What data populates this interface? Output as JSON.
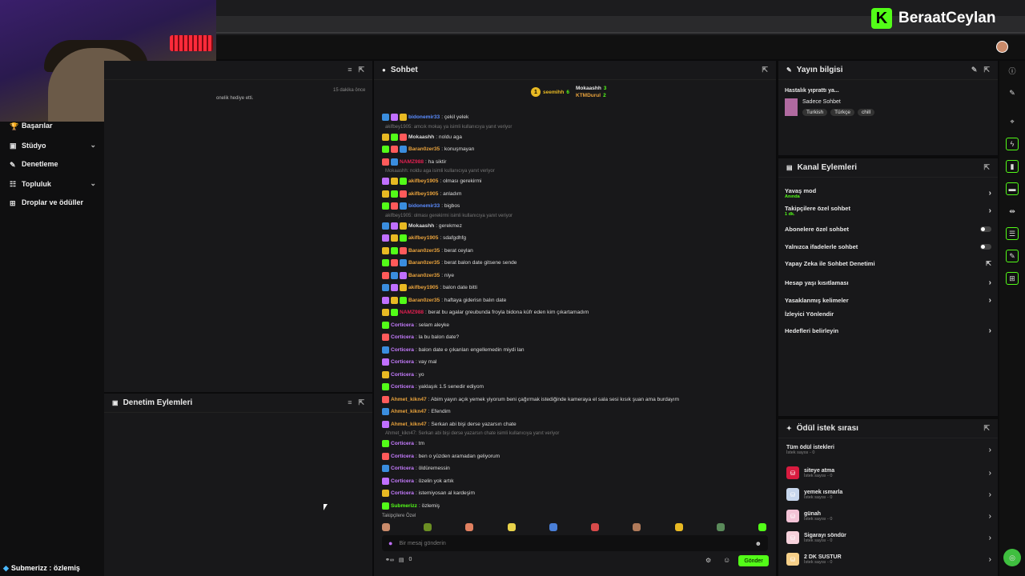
{
  "brand": {
    "logo_letter": "K",
    "name": "BeraatCeylan"
  },
  "sidebar": {
    "items": [
      {
        "label": "Başarılar",
        "icon": "trophy-icon"
      },
      {
        "label": "Stüdyo",
        "icon": "video-icon",
        "expand": true
      },
      {
        "label": "Denetleme",
        "icon": "wrench-icon"
      },
      {
        "label": "Topluluk",
        "icon": "people-icon",
        "expand": true
      },
      {
        "label": "Droplar ve ödüller",
        "icon": "gift-icon"
      }
    ]
  },
  "activity": {
    "snippet": "onelik hediye etti.",
    "time": "15 dakika önce"
  },
  "mod_actions": {
    "title": "Denetim Eylemleri"
  },
  "chat": {
    "title": "Sohbet",
    "leaderboard": [
      {
        "name": "seemihh",
        "count": "6"
      },
      {
        "name": "Mokaashh",
        "count": "3"
      },
      {
        "name": "KTMDurul",
        "count": "2"
      }
    ],
    "messages": [
      {
        "user": "bidonemir33",
        "text": ": çekil yelek",
        "color": "#5b8cff"
      },
      {
        "reply": "akifbey1905: amcık mokaş ya isimli kullanıcıya yanıt veriyor"
      },
      {
        "user": "Mokaashh",
        "text": ": noldu aga",
        "color": "#dddddd"
      },
      {
        "user": "Baran0zer35",
        "text": ": konuşmayan",
        "color": "#e8a23c"
      },
      {
        "user": "NAMZ988",
        "text": ": ha siktir",
        "color": "#e02050"
      },
      {
        "reply": "Mokaashh: noldu aga isimli kullanıcıya yanıt veriyor"
      },
      {
        "user": "akifbey1905",
        "text": ": olması gerekirmi",
        "color": "#e8a23c"
      },
      {
        "user": "akifbey1905",
        "text": ": anladım",
        "color": "#e8a23c"
      },
      {
        "user": "bidonemir33",
        "text": ": bigbos",
        "color": "#5b8cff"
      },
      {
        "reply": "akifbey1905: olması gerekirmi isimli kullanıcıya yanıt veriyor"
      },
      {
        "user": "Mokaashh",
        "text": ": gerekmez",
        "color": "#dddddd"
      },
      {
        "user": "akifbey1905",
        "text": ": sdafgdhfg",
        "color": "#e8a23c"
      },
      {
        "user": "Baran0zer35",
        "text": ": berat ceylan",
        "color": "#e8a23c"
      },
      {
        "user": "Baran0zer35",
        "text": ": berat balon date gitsene sende",
        "color": "#e8a23c"
      },
      {
        "user": "Baran0zer35",
        "text": ": niye",
        "color": "#e8a23c"
      },
      {
        "user": "akifbey1905",
        "text": ": balon date bitti",
        "color": "#e8a23c"
      },
      {
        "user": "Baran0zer35",
        "text": ": haftaya giderisn balın date",
        "color": "#e8a23c"
      },
      {
        "user": "NAMZ988",
        "text": ": berat bu agalar greubunda froyla bidona küfr eden kim çıkartamadım",
        "color": "#e02050"
      },
      {
        "user": "Corticera",
        "text": ": selam aleyke",
        "color": "#c67cff"
      },
      {
        "user": "Corticera",
        "text": ": la bu balon date?",
        "color": "#c67cff"
      },
      {
        "user": "Corticera",
        "text": ": balon date e çıkanları engellemedin miydi lan",
        "color": "#c67cff"
      },
      {
        "user": "Corticera",
        "text": ": vay mal",
        "color": "#c67cff"
      },
      {
        "user": "Corticera",
        "text": ": yo",
        "color": "#c67cff"
      },
      {
        "user": "Corticera",
        "text": ": yaklaşık 1.5 senedir ediyom",
        "color": "#c67cff"
      },
      {
        "user": "Ahmet_kikn47",
        "text": ": Abim yayın açık yemek yiyorum beni çağırmak istediğinde kameraya el sala sesi kısık şuan ama burdayım",
        "color": "#e8a23c"
      },
      {
        "user": "Ahmet_kikn47",
        "text": ": Efendim",
        "color": "#e8a23c"
      },
      {
        "user": "Ahmet_kikn47",
        "text": ": Serkan abi bişi derse yazarsın chate",
        "color": "#e8a23c"
      },
      {
        "reply": "Ahmet_kikn47: Serkan abi bişi derse yazarsın chate isimli kullanıcıya yanıt veriyor"
      },
      {
        "user": "Corticera",
        "text": ": tm",
        "color": "#c67cff"
      },
      {
        "user": "Corticera",
        "text": ": ben o yüzden aramadan geliyorum",
        "color": "#c67cff"
      },
      {
        "user": "Corticera",
        "text": ": öldüremessin",
        "color": "#c67cff"
      },
      {
        "user": "Corticera",
        "text": ": özelin yok artık",
        "color": "#c67cff"
      },
      {
        "user": "Corticera",
        "text": ": istemiyosan al kardeşim",
        "color": "#c67cff"
      },
      {
        "user": "Submerizz",
        "text": ": özlemiş",
        "color": "#53fc18"
      }
    ],
    "followers_only": "Takipçilere Özel",
    "input_placeholder": "Bir mesaj gönderin",
    "count": "0",
    "send_label": "Gönder"
  },
  "stream_info": {
    "title": "Yayın bilgisi",
    "stream_title": "Hastalık yıprattı ya...",
    "category": "Sadece Sohbet",
    "tags": [
      "Turkish",
      "Türkçe",
      "chill"
    ]
  },
  "channel_actions": {
    "title": "Kanal Eylemleri",
    "rows": [
      {
        "label": "Yavaş mod",
        "sub": "Anında",
        "control": "chevron"
      },
      {
        "label": "Takipçilere özel sohbet",
        "sub": "1 dk.",
        "control": "chevron"
      },
      {
        "label": "Abonelere özel sohbet",
        "sub": "",
        "control": "toggle"
      },
      {
        "label": "Yalnızca ifadelerle sohbet",
        "sub": "",
        "control": "toggle"
      },
      {
        "label": "Yapay Zeka ile Sohbet Denetimi",
        "sub": "",
        "control": "external"
      },
      {
        "label": "Hesap yaşı kısıtlaması",
        "sub": "",
        "control": "chevron"
      },
      {
        "label": "Yasaklanmış kelimeler",
        "sub": "",
        "control": "chevron"
      },
      {
        "label": "İzleyici Yönlendir",
        "sub": "",
        "control": "none"
      },
      {
        "label": "Hedefleri belirleyin",
        "sub": "",
        "control": "chevron"
      }
    ]
  },
  "reward_queue": {
    "title": "Ödül istek sırası",
    "all_label": "Tüm ödül istekleri",
    "all_sub": "İstek sayısı - 0",
    "items": [
      {
        "label": "siteye atma",
        "sub": "İstek sayısı - 0",
        "color": "#d81b3f"
      },
      {
        "label": "yemek ısmarla",
        "sub": "İstek sayısı - 0",
        "color": "#c7d6ec"
      },
      {
        "label": "günah",
        "sub": "İstek sayısı - 0",
        "color": "#f3c3d6"
      },
      {
        "label": "Sigarayı söndür",
        "sub": "İstek sayısı - 0",
        "color": "#f7d2dc"
      },
      {
        "label": "2 DK SUSTUR",
        "sub": "İstek sayısı - 0",
        "color": "#f7d089"
      }
    ]
  },
  "footer": {
    "text": "Submerizz : özlemiş"
  }
}
